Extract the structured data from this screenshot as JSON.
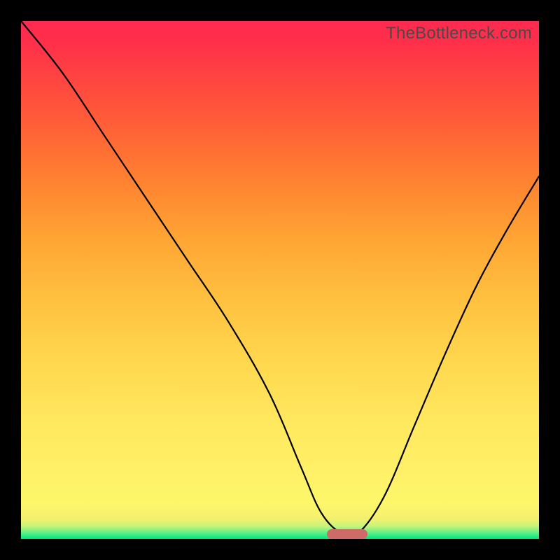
{
  "watermark": "TheBottleneck.com",
  "chart_data": {
    "type": "line",
    "title": "",
    "xlabel": "",
    "ylabel": "",
    "xlim": [
      0,
      100
    ],
    "ylim": [
      0,
      100
    ],
    "grid": false,
    "series": [
      {
        "name": "bottleneck-curve",
        "x": [
          0,
          8,
          16,
          24,
          32,
          40,
          48,
          54,
          58,
          62,
          65,
          70,
          76,
          82,
          88,
          94,
          100
        ],
        "values": [
          100,
          90,
          78,
          66,
          54,
          42,
          28,
          14,
          5,
          1,
          1,
          8,
          22,
          36,
          49,
          60,
          70
        ]
      }
    ],
    "indicator": {
      "x": 63,
      "y": 1
    },
    "gradient_stops": [
      {
        "pos": 0,
        "color": "#00e67a"
      },
      {
        "pos": 10,
        "color": "#fef76a"
      },
      {
        "pos": 50,
        "color": "#ffc13f"
      },
      {
        "pos": 100,
        "color": "#ff2a50"
      }
    ]
  }
}
